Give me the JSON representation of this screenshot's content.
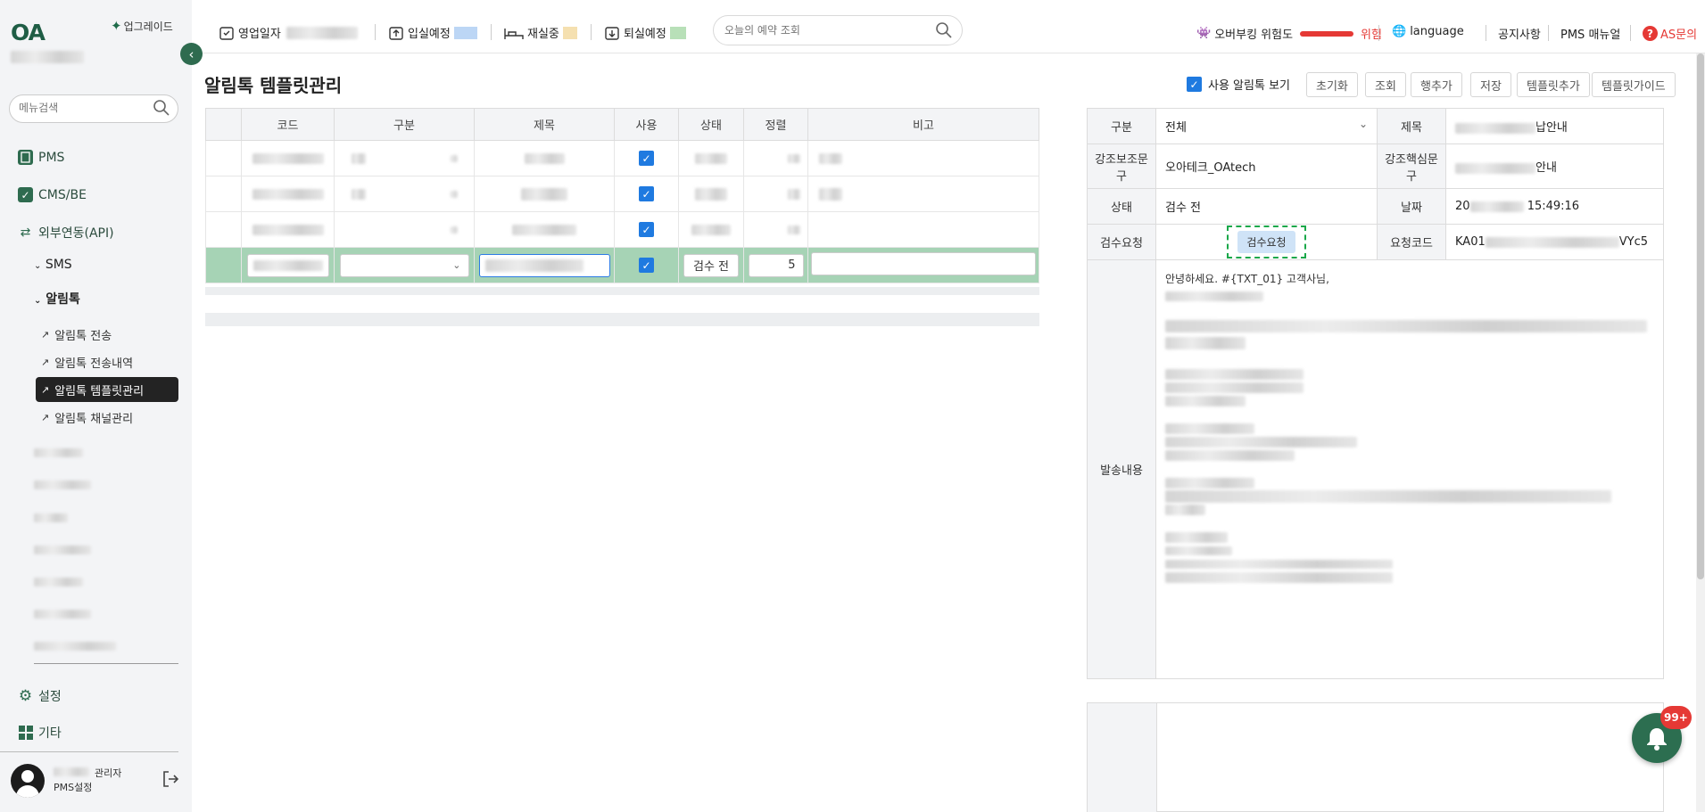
{
  "sidebar": {
    "logo": "OA",
    "upgrade_label": "업그레이드",
    "search_placeholder": "메뉴검색",
    "items": [
      {
        "label": "PMS"
      },
      {
        "label": "CMS/BE"
      },
      {
        "label": "외부연동(API)"
      }
    ],
    "sub_items": [
      {
        "label": "SMS"
      },
      {
        "label": "알림톡"
      }
    ],
    "alimtalk_items": [
      {
        "label": "알림톡 전송"
      },
      {
        "label": "알림톡 전송내역"
      },
      {
        "label": "알림톡 템플릿관리"
      },
      {
        "label": "알림톡 채널관리"
      }
    ],
    "settings_label": "설정",
    "etc_label": "기타",
    "user_role": "관리자",
    "user_sub": "PMS설정"
  },
  "topbar": {
    "business_date_label": "영업일자",
    "checkin_label": "입실예정",
    "occupied_label": "재실중",
    "checkout_label": "퇴실예정",
    "search_placeholder": "오늘의 예약 조회",
    "overbooking_label": "오버부킹 위험도",
    "risk_label": "위험",
    "language_label": "language",
    "notice_label": "공지사항",
    "manual_label": "PMS 매뉴얼",
    "as_label": "AS문의",
    "colors": {
      "risk": "#e53935",
      "checkin": "#bcd6f5",
      "occupied": "#f5e0b0",
      "checkout": "#b8e0b8"
    }
  },
  "main": {
    "title": "알림톡 템플릿관리",
    "show_used_label": "사용 알림톡 보기",
    "buttons": {
      "reset": "초기화",
      "search": "조회",
      "add_row": "행추가",
      "save": "저장",
      "add_template": "템플릿추가",
      "template_guide": "템플릿가이드"
    },
    "grid": {
      "headers": [
        "코드",
        "구분",
        "제목",
        "사용",
        "상태",
        "정렬",
        "비고"
      ],
      "selected_row": {
        "status": "검수 전",
        "order": "5"
      }
    }
  },
  "detail": {
    "category_label": "구분",
    "category_value": "전체",
    "title_label": "제목",
    "title_value": "납안내",
    "emph_sub_label": "강조보조문구",
    "emph_sub_value": "오아테크_OAtech",
    "emph_core_label": "강조핵심문구",
    "emph_core_value": "안내",
    "status_label": "상태",
    "status_value": "검수 전",
    "date_label": "날짜",
    "date_prefix": "20",
    "date_value": "15:49:16",
    "review_label": "검수요청",
    "review_button": "검수요청",
    "request_code_label": "요청코드",
    "request_code_prefix": "KA01",
    "request_code_suffix": "VYc5",
    "content_label": "발송내용",
    "content_first_line": "안녕하세요. #{TXT_01} 고객사님,"
  },
  "notifications": {
    "badge": "99+"
  }
}
